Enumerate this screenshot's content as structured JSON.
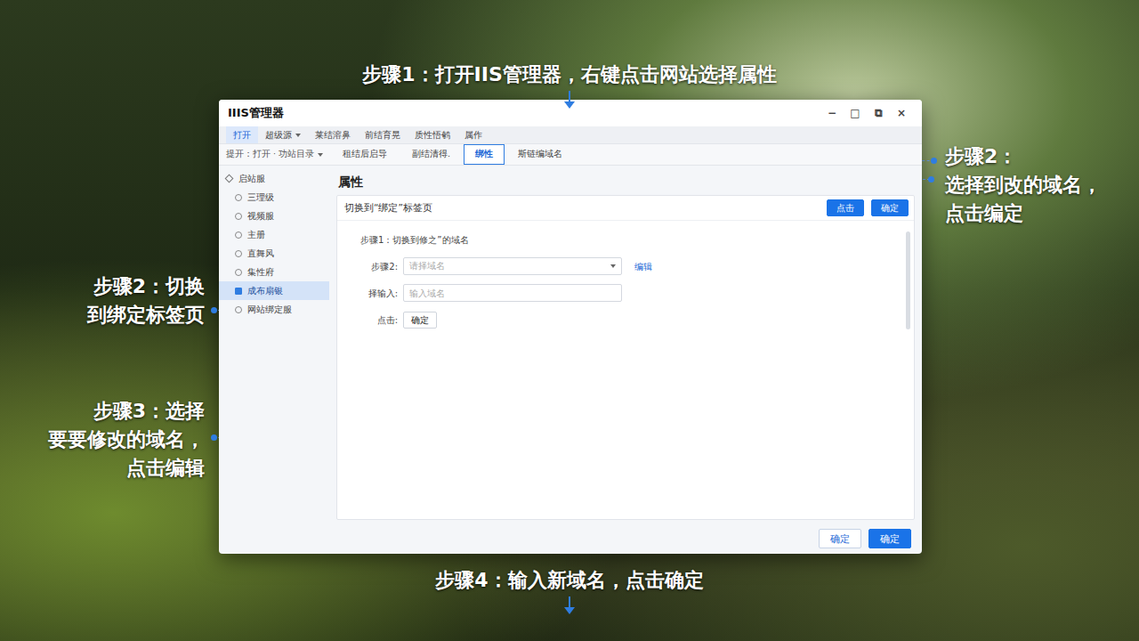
{
  "annotations": [
    {
      "lines": [
        "步骤1：打开IIS管理器，右键点击网站选择属性"
      ],
      "place": "top"
    },
    {
      "lines": [
        "步骤2：",
        "选择到改的域名，",
        "点击编定"
      ],
      "place": "right"
    },
    {
      "lines": [
        "步骤2：切换",
        "到绑定标签页"
      ],
      "place": "left-upper"
    },
    {
      "lines": [
        "步骤3：选择",
        "要要修改的域名，",
        "点击编辑"
      ],
      "place": "left-lower"
    },
    {
      "lines": [
        "步骤4：输入新域名，点击确定"
      ],
      "place": "bottom"
    }
  ],
  "window": {
    "title": "IIIS管理器",
    "controls": [
      "−",
      "□",
      "⧉",
      "×"
    ]
  },
  "menu": [
    {
      "label": "打开",
      "selected": true
    },
    {
      "label": "超级源",
      "selected": false
    },
    {
      "label": "莱结溶鼻",
      "selected": false
    },
    {
      "label": "前结育晃",
      "selected": false
    },
    {
      "label": "质性悟鹌",
      "selected": false
    },
    {
      "label": "属作",
      "selected": false
    }
  ],
  "location": "提开：打开 · 功站目录",
  "tabs": [
    {
      "label": "租结后启导",
      "selected": false
    },
    {
      "label": "副结清得.",
      "selected": false
    },
    {
      "label": "绑性",
      "selected": true
    },
    {
      "label": "斯链编域名",
      "selected": false
    }
  ],
  "sidebar": {
    "header": "启站服",
    "items": [
      {
        "label": "三理级",
        "selected": false
      },
      {
        "label": "视频服",
        "selected": false
      },
      {
        "label": "主册",
        "selected": false
      },
      {
        "label": "直舞风",
        "selected": false
      },
      {
        "label": "集性府",
        "selected": false
      },
      {
        "label": "成布扇银",
        "selected": true
      },
      {
        "label": "网站绑定服",
        "selected": false
      }
    ]
  },
  "panel": {
    "title": "属性",
    "header": "切换到“绑定”标签页",
    "header_buttons": [
      "点击",
      "确定"
    ],
    "intro": "步骤1：切换到修之”的域名",
    "fields": [
      {
        "kind": "select",
        "label": "步骤2:",
        "placeholder": "请择域名",
        "link": "编辑"
      },
      {
        "kind": "input",
        "label": "择输入:",
        "placeholder": "输入域名"
      },
      {
        "kind": "button",
        "label": "点击:",
        "button": "确定"
      }
    ]
  },
  "footer_buttons": [
    "确定",
    "确定"
  ]
}
